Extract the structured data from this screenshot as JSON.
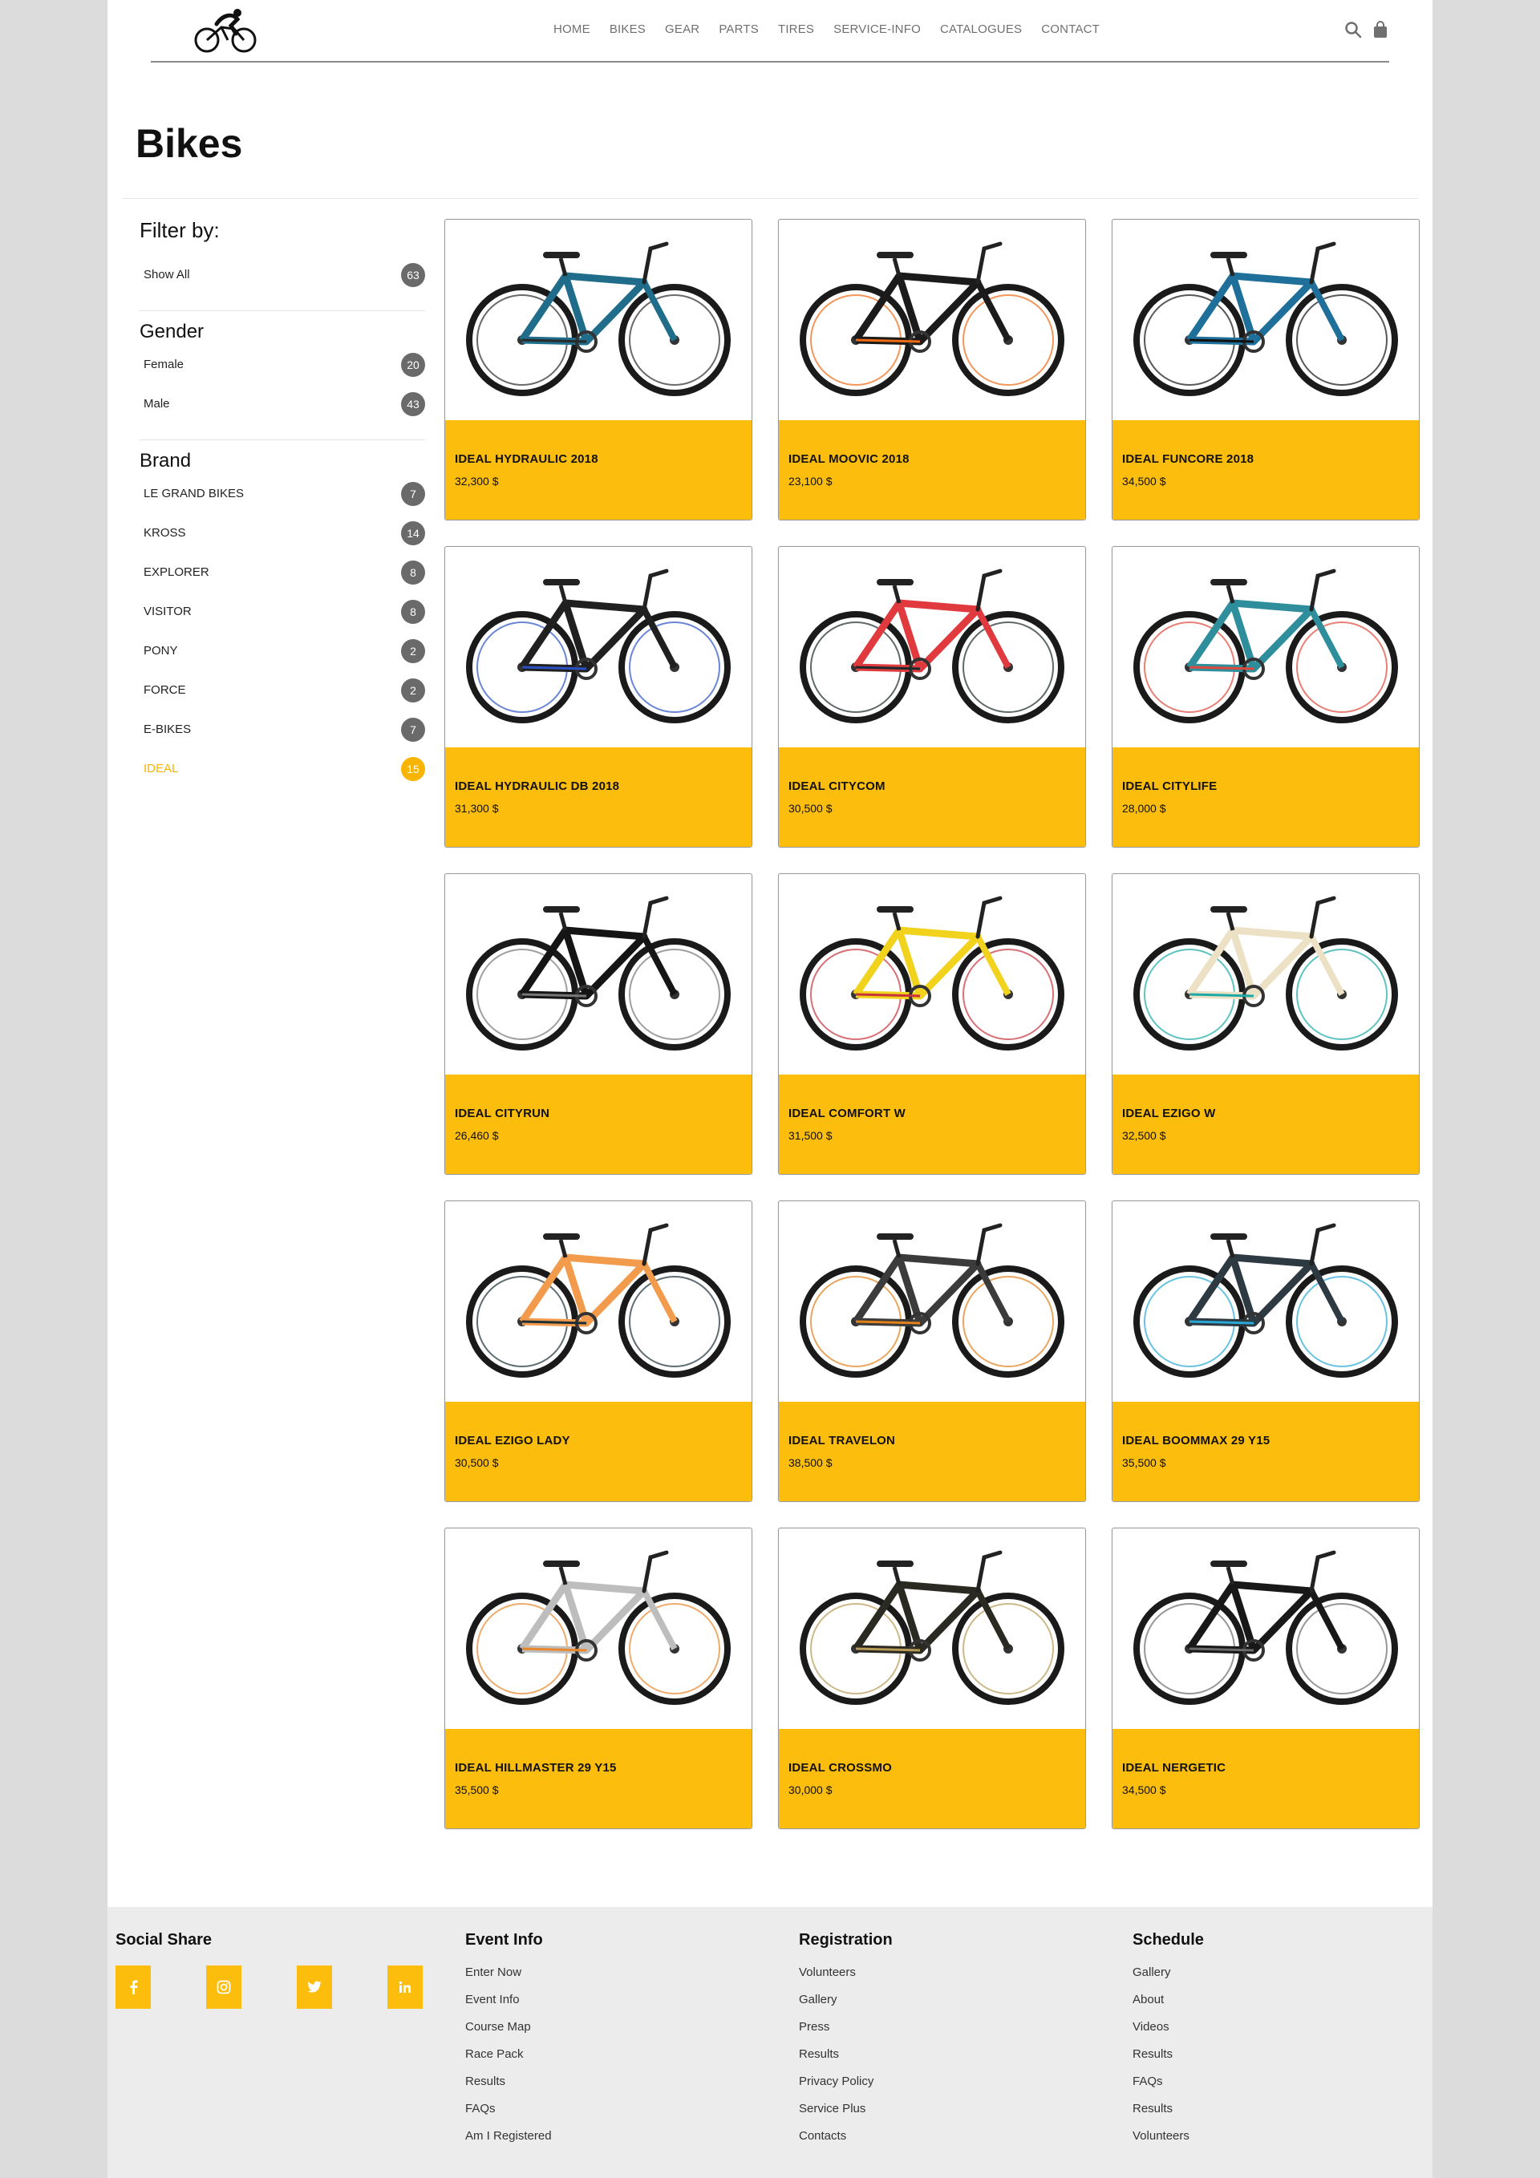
{
  "header": {
    "nav": [
      "HOME",
      "BIKES",
      "GEAR",
      "PARTS",
      "TIRES",
      "SERVICE-INFO",
      "CATALOGUES",
      "CONTACT"
    ]
  },
  "page_title": "Bikes",
  "filters": {
    "title": "Filter by:",
    "show_all": {
      "label": "Show All",
      "count": "63"
    },
    "gender": {
      "title": "Gender",
      "items": [
        {
          "label": "Female",
          "count": "20"
        },
        {
          "label": "Male",
          "count": "43"
        }
      ]
    },
    "brand": {
      "title": "Brand",
      "items": [
        {
          "label": "LE GRAND BIKES",
          "count": "7"
        },
        {
          "label": "KROSS",
          "count": "14"
        },
        {
          "label": "EXPLORER",
          "count": "8"
        },
        {
          "label": "VISITOR",
          "count": "8"
        },
        {
          "label": "PONY",
          "count": "2"
        },
        {
          "label": "FORCE",
          "count": "2"
        },
        {
          "label": "E-BIKES",
          "count": "7"
        },
        {
          "label": "IDEAL",
          "count": "15"
        }
      ],
      "active": "IDEAL"
    }
  },
  "products": [
    {
      "name": "IDEAL HYDRAULIC 2018",
      "price": "32,300 $",
      "frame": "#1f6d8a",
      "accent": "#2a2a2a"
    },
    {
      "name": "IDEAL MOOVIC 2018",
      "price": "23,100 $",
      "frame": "#1b1b1b",
      "accent": "#ef6a12"
    },
    {
      "name": "IDEAL FUNCORE 2018",
      "price": "34,500 $",
      "frame": "#1e6f9a",
      "accent": "#111111"
    },
    {
      "name": "IDEAL HYDRAULIC DB 2018",
      "price": "31,300 $",
      "frame": "#202020",
      "accent": "#2b52c4"
    },
    {
      "name": "IDEAL CITYCOM",
      "price": "30,500 $",
      "frame": "#e03a3e",
      "accent": "#1d2a2a"
    },
    {
      "name": "IDEAL CITYLIFE",
      "price": "28,000 $",
      "frame": "#2f8e9c",
      "accent": "#e0483b"
    },
    {
      "name": "IDEAL CITYRUN",
      "price": "26,460 $",
      "frame": "#151515",
      "accent": "#777777"
    },
    {
      "name": "IDEAL COMFORT W",
      "price": "31,500 $",
      "frame": "#f1d21c",
      "accent": "#c8323b"
    },
    {
      "name": "IDEAL EZIGO W",
      "price": "32,500 $",
      "frame": "#ece1c4",
      "accent": "#1aa9a6"
    },
    {
      "name": "IDEAL EZIGO LADY",
      "price": "30,500 $",
      "frame": "#f29b4c",
      "accent": "#1c2f36"
    },
    {
      "name": "IDEAL TRAVELON",
      "price": "38,500 $",
      "frame": "#3b3b3b",
      "accent": "#e2801a"
    },
    {
      "name": "IDEAL BOOMMAX 29 Y15",
      "price": "35,500 $",
      "frame": "#2d3a42",
      "accent": "#2aa8d5"
    },
    {
      "name": "IDEAL HILLMASTER 29 Y15",
      "price": "35,500 $",
      "frame": "#bdbdbd",
      "accent": "#e8872c"
    },
    {
      "name": "IDEAL CROSSMO",
      "price": "30,000 $",
      "frame": "#2b2a22",
      "accent": "#b79a55"
    },
    {
      "name": "IDEAL NERGETIC",
      "price": "34,500 $",
      "frame": "#181818",
      "accent": "#6b6b6b"
    }
  ],
  "footer": {
    "social": {
      "title": "Social Share",
      "icons": [
        "facebook-icon",
        "instagram-icon",
        "twitter-icon",
        "linkedin-icon"
      ]
    },
    "event_info": {
      "title": "Event Info",
      "links": [
        "Enter Now",
        "Event Info",
        "Course Map",
        "Race Pack",
        "Results",
        "FAQs",
        "Am I Registered"
      ]
    },
    "registration": {
      "title": "Registration",
      "links": [
        "Volunteers",
        "Gallery",
        "Press",
        "Results",
        "Privacy Policy",
        "Service Plus",
        "Contacts"
      ]
    },
    "schedule": {
      "title": "Schedule",
      "links": [
        "Gallery",
        "About",
        "Videos",
        "Results",
        "FAQs",
        "Results",
        "Volunteers"
      ]
    }
  },
  "colors": {
    "accent": "#fcbd0c",
    "active_filter": "#f7b500",
    "badge": "#6a6a6a"
  }
}
